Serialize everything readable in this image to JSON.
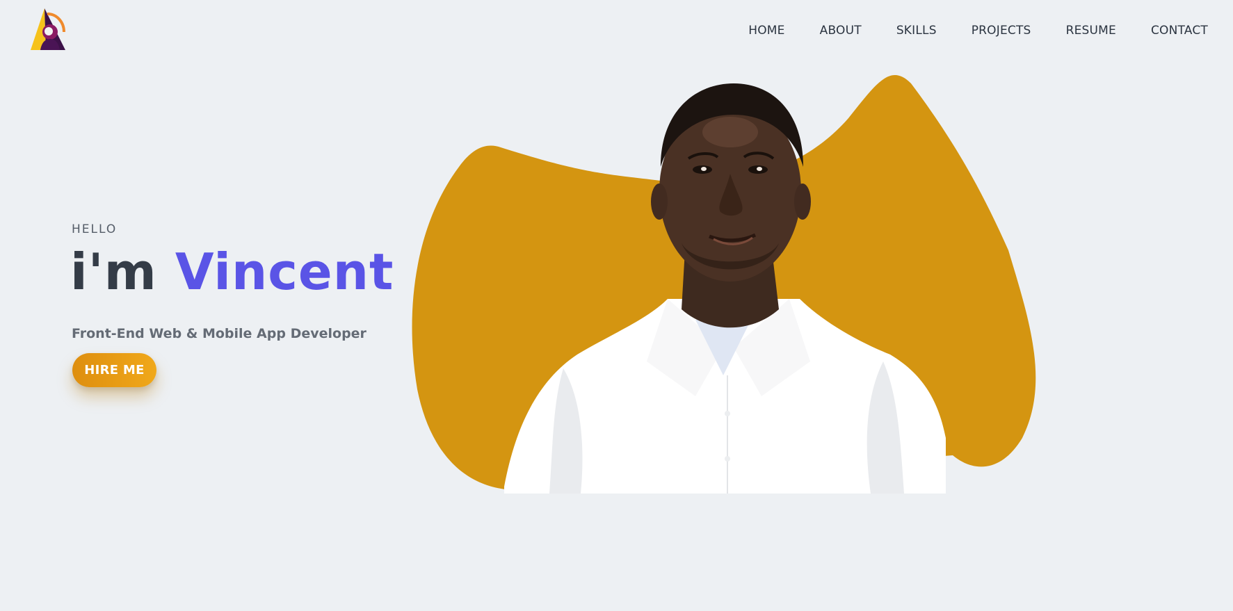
{
  "header": {
    "nav": [
      "HOME",
      "ABOUT",
      "SKILLS",
      "PROJECTS",
      "RESUME",
      "CONTACT"
    ]
  },
  "hero": {
    "greeting": "HELLO",
    "intro": "i'm",
    "name": "Vincent",
    "role": "Front-End Web & Mobile App Developer",
    "cta_label": "HIRE ME"
  },
  "colors": {
    "background": "#edf0f3",
    "accent_gold": "#d49511",
    "accent_purple": "#5a54e6",
    "text_dark": "#343c47"
  },
  "icons": {
    "logo": "triangle-person-logo"
  }
}
